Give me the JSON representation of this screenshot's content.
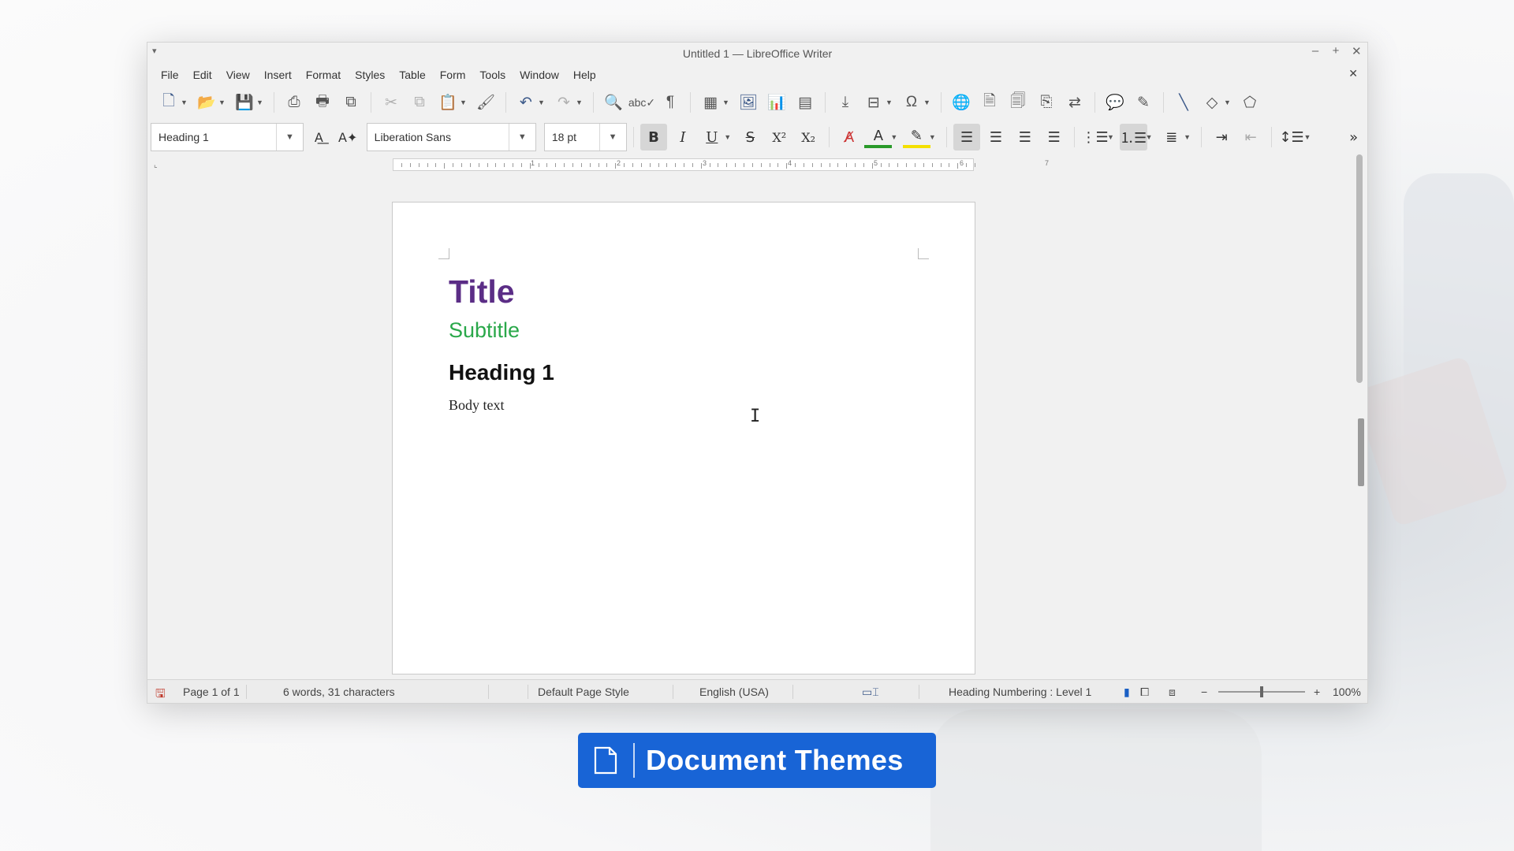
{
  "window": {
    "title": "Untitled 1 — LibreOffice Writer",
    "menu_glyph": "▾",
    "controls": [
      "–",
      "+",
      "✕"
    ]
  },
  "menubar": {
    "items": [
      "File",
      "Edit",
      "View",
      "Insert",
      "Format",
      "Styles",
      "Table",
      "Form",
      "Tools",
      "Window",
      "Help"
    ],
    "close_glyph": "✕"
  },
  "toolbar": {
    "icons": [
      "new-document-icon",
      "open-folder-icon",
      "save-icon",
      "export-pdf-icon",
      "print-icon",
      "print-preview-icon",
      "cut-icon",
      "copy-icon",
      "paste-icon",
      "clone-formatting-icon",
      "undo-icon",
      "redo-icon",
      "find-replace-icon",
      "spellcheck-icon",
      "formatting-marks-icon",
      "insert-table-icon",
      "insert-image-icon",
      "insert-chart-icon",
      "insert-textbox-icon",
      "page-break-icon",
      "insert-field-icon",
      "special-character-icon",
      "hyperlink-icon",
      "footnote-icon",
      "endnote-icon",
      "bookmark-icon",
      "cross-reference-icon",
      "comment-icon",
      "track-changes-icon",
      "line-icon",
      "shapes-icon",
      "draw-functions-icon"
    ]
  },
  "format_toolbar": {
    "paragraph_style": "Heading 1",
    "font_name": "Liberation Sans",
    "font_size": "18 pt",
    "bold_label": "B",
    "italic_label": "I",
    "underline_label": "U",
    "strike_label": "S",
    "superscript_label": "X²",
    "subscript_label": "X₂",
    "more_glyph": "»"
  },
  "ruler": {
    "numbers": [
      "1",
      "2",
      "3",
      "4",
      "5",
      "6",
      "7"
    ]
  },
  "document": {
    "title": "Title",
    "subtitle": "Subtitle",
    "heading1": "Heading 1",
    "body": "Body text"
  },
  "statusbar": {
    "page": "Page 1 of 1",
    "word_count": "6 words, 31 characters",
    "page_style": "Default Page Style",
    "language": "English (USA)",
    "outline": "Heading Numbering : Level 1",
    "zoom": "100%"
  },
  "badge": {
    "text": "Document Themes"
  },
  "colors": {
    "title": "#5b2d86",
    "subtitle": "#2aa84a",
    "badge": "#1864d6"
  }
}
